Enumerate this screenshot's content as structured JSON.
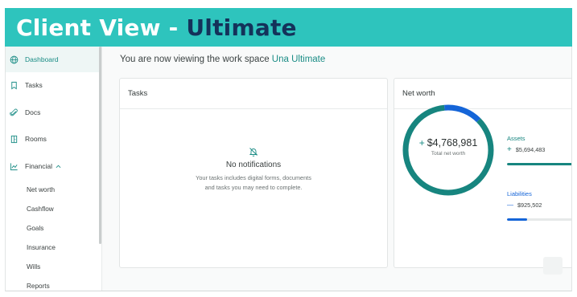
{
  "banner": {
    "title_part1": "Client View - ",
    "title_part2": "Ultimate"
  },
  "sidebar": {
    "items": [
      {
        "label": "Dashboard",
        "icon": "globe-icon",
        "active": true
      },
      {
        "label": "Tasks",
        "icon": "bookmark-icon",
        "active": false
      },
      {
        "label": "Docs",
        "icon": "paperclip-icon",
        "active": false
      },
      {
        "label": "Rooms",
        "icon": "door-icon",
        "active": false
      },
      {
        "label": "Financial",
        "icon": "trend-chart-icon",
        "active": false,
        "expanded": true
      }
    ],
    "financial_sub": [
      "Net worth",
      "Cashflow",
      "Goals",
      "Insurance",
      "Wills",
      "Reports"
    ]
  },
  "main": {
    "workspace_prefix": "You are now viewing the work space ",
    "workspace_name": "Una Ultimate"
  },
  "tasks_card": {
    "title": "Tasks",
    "empty_icon": "bell-off-icon",
    "empty_title": "No notifications",
    "empty_desc": "Your tasks includes digital forms, documents and tasks you may need to complete."
  },
  "networth_card": {
    "title": "Net worth",
    "total_value": "$4,768,981",
    "total_label": "Total net worth",
    "assets": {
      "label": "Assets",
      "value": "$5,694,483",
      "sign": "+",
      "fill": 0.85
    },
    "liabilities": {
      "label": "Liabilities",
      "value": "$925,502",
      "sign": "—",
      "fill": 0.25
    },
    "donut": {
      "assets_share": 0.86,
      "liabilities_share": 0.14
    },
    "colors": {
      "assets": "#17857f",
      "liabilities": "#1565d8",
      "accent": "#1a8c85",
      "banner": "#2ec4bd"
    }
  }
}
